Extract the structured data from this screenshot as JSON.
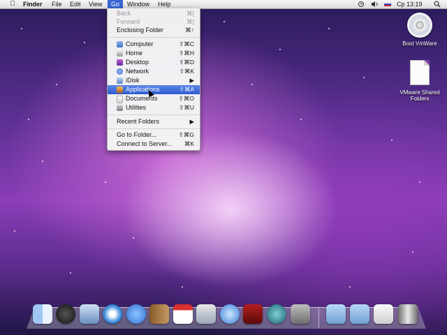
{
  "menubar": {
    "app_name": "Finder",
    "menus": [
      "File",
      "Edit",
      "View",
      "Go",
      "Window",
      "Help"
    ],
    "clock": "Ср 13:19"
  },
  "go_menu": {
    "items": [
      {
        "label": "Back",
        "shortcut": "⌘[",
        "disabled": true
      },
      {
        "label": "Forward",
        "shortcut": "⌘]",
        "disabled": true
      },
      {
        "label": "Enclosing Folder",
        "shortcut": "⌘↑"
      },
      {
        "label": "Computer",
        "shortcut": "⇧⌘C",
        "icon": "computer-icon"
      },
      {
        "label": "Home",
        "shortcut": "⇧⌘H",
        "icon": "home-icon"
      },
      {
        "label": "Desktop",
        "shortcut": "⇧⌘D",
        "icon": "desktop-icon"
      },
      {
        "label": "Network",
        "shortcut": "⇧⌘K",
        "icon": "network-icon"
      },
      {
        "label": "iDisk",
        "shortcut": "▶",
        "icon": "idisk-icon"
      },
      {
        "label": "Applications",
        "shortcut": "⇧⌘A",
        "icon": "applications-icon",
        "highlighted": true
      },
      {
        "label": "Documents",
        "shortcut": "⇧⌘O",
        "icon": "documents-icon"
      },
      {
        "label": "Utilities",
        "shortcut": "⇧⌘U",
        "icon": "utilities-icon"
      },
      {
        "label": "Recent Folders",
        "shortcut": "▶"
      },
      {
        "label": "Go to Folder...",
        "shortcut": "⇧⌘G"
      },
      {
        "label": "Connect to Server...",
        "shortcut": "⌘K"
      }
    ]
  },
  "desktop_icons": [
    {
      "label": "Boot VmWare",
      "icon": "dvd-icon"
    },
    {
      "label": "VMware Shared Folders",
      "icon": "document-icon"
    }
  ],
  "dock_items": [
    "finder-icon",
    "dashboard-icon",
    "mail-icon",
    "safari-icon",
    "ichat-icon",
    "address-book-icon",
    "ical-icon",
    "preview-icon",
    "itunes-icon",
    "front-row-icon",
    "time-machine-icon",
    "system-preferences-icon",
    "applications-folder-icon",
    "documents-folder-icon",
    "downloads-stack-icon",
    "trash-icon"
  ]
}
